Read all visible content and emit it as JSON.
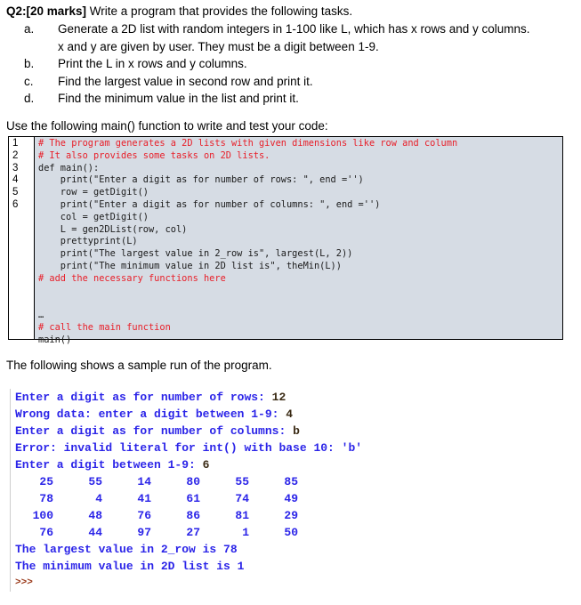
{
  "question": {
    "heading_bold": "Q2:[20 marks]",
    "heading_text": " Write a program that provides the following tasks.",
    "tasks": [
      {
        "label": "a.",
        "text": "Generate a 2D list with random integers in 1-100 like L, which has x rows and y columns.",
        "cont": "x and y are given by user. They must be a digit between 1-9."
      },
      {
        "label": "b.",
        "text": "Print the L in x rows and y columns."
      },
      {
        "label": "c.",
        "text": "Find the largest value in second row and print it."
      },
      {
        "label": "d.",
        "text": "Find the minimum value in the list and print it."
      }
    ]
  },
  "code_intro": "Use the following main() function to write and test your code:",
  "code": {
    "line_numbers": [
      "1",
      "2",
      "3",
      "4",
      "5",
      "6"
    ],
    "lines": [
      {
        "type": "comment",
        "text": "# The program generates a 2D lists with given dimensions like row and column"
      },
      {
        "type": "comment",
        "text": "# It also provides some tasks on 2D lists."
      },
      {
        "type": "code",
        "text": "def main():"
      },
      {
        "type": "code",
        "text": "    print(\"Enter a digit as for number of rows: \", end ='')"
      },
      {
        "type": "code",
        "text": "    row = getDigit()"
      },
      {
        "type": "code",
        "text": "    print(\"Enter a digit as for number of columns: \", end ='')"
      },
      {
        "type": "code",
        "text": "    col = getDigit()"
      },
      {
        "type": "code",
        "text": "    L = gen2DList(row, col)"
      },
      {
        "type": "code",
        "text": "    prettyprint(L)"
      },
      {
        "type": "code",
        "text": "    print(\"The largest value in 2_row is\", largest(L, 2))"
      },
      {
        "type": "code",
        "text": "    print(\"The minimum value in 2D list is\", theMin(L))"
      },
      {
        "type": "comment",
        "text": "# add the necessary functions here"
      },
      {
        "type": "code",
        "text": ""
      },
      {
        "type": "code",
        "text": ""
      },
      {
        "type": "code",
        "text": "…"
      },
      {
        "type": "comment",
        "text": "# call the main function"
      },
      {
        "type": "code",
        "text": "main()"
      }
    ]
  },
  "sample_intro": "The following shows a sample run of the program.",
  "shell": {
    "lines": [
      {
        "text": "Enter a digit as for number of rows: ",
        "input": "12"
      },
      {
        "text": "Wrong data: enter a digit between 1-9: ",
        "input": "4"
      },
      {
        "text": "Enter a digit as for number of columns: ",
        "input": "b"
      },
      {
        "text": "Error: invalid literal for int() with base 10: 'b'",
        "input": ""
      },
      {
        "text": "Enter a digit between 1-9: ",
        "input": "6"
      }
    ],
    "grid": [
      [
        "25",
        "55",
        "14",
        "80",
        "55",
        "85"
      ],
      [
        "78",
        "4",
        "41",
        "61",
        "74",
        "49"
      ],
      [
        "100",
        "48",
        "76",
        "86",
        "81",
        "29"
      ],
      [
        "76",
        "44",
        "97",
        "27",
        "1",
        "50"
      ]
    ],
    "results": [
      "The largest value in 2_row is 78",
      "The minimum value in 2D list is 1"
    ],
    "prompt": ">>>"
  }
}
